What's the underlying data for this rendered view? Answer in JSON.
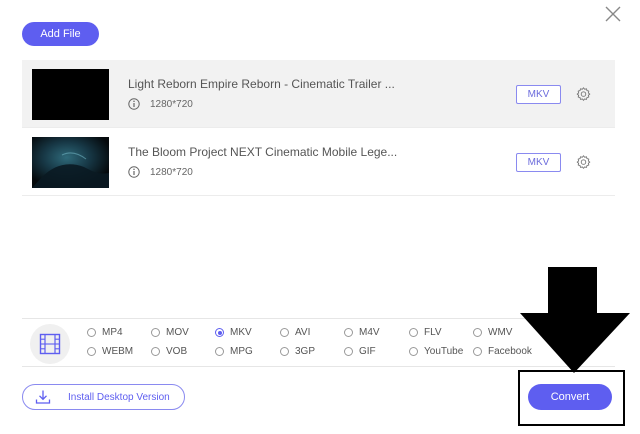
{
  "toolbar": {
    "add_file_label": "Add File"
  },
  "files": [
    {
      "name": "Light Reborn Empire Reborn - Cinematic Trailer ...",
      "resolution": "1280*720",
      "format": "MKV"
    },
    {
      "name": "The Bloom Project NEXT Cinematic Mobile Lege...",
      "resolution": "1280*720",
      "format": "MKV"
    }
  ],
  "formats": {
    "selected": "MKV",
    "row1": [
      "MP4",
      "MOV",
      "MKV",
      "AVI",
      "M4V",
      "FLV",
      "WMV"
    ],
    "row2": [
      "WEBM",
      "VOB",
      "MPG",
      "3GP",
      "GIF",
      "YouTube",
      "Facebook"
    ]
  },
  "footer": {
    "install_label": "Install Desktop Version",
    "convert_label": "Convert"
  },
  "colors": {
    "accent": "#5e5ef0",
    "badge_border": "#8a8af0"
  },
  "icons": [
    "close-icon",
    "info-icon",
    "gear-icon",
    "film-icon",
    "download-icon",
    "arrow-down-annotation"
  ]
}
